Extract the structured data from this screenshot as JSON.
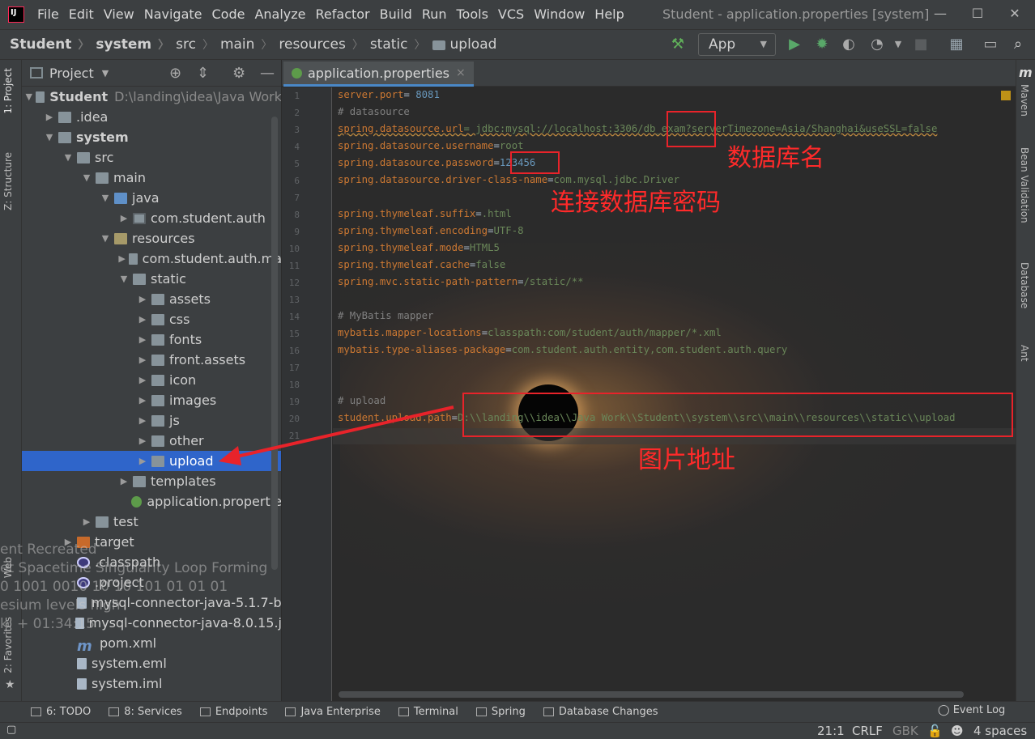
{
  "window": {
    "title": "Student - application.properties [system]"
  },
  "menu": [
    {
      "label": "File"
    },
    {
      "label": "Edit"
    },
    {
      "label": "View"
    },
    {
      "label": "Navigate"
    },
    {
      "label": "Code"
    },
    {
      "label": "Analyze"
    },
    {
      "label": "Refactor"
    },
    {
      "label": "Build"
    },
    {
      "label": "Run"
    },
    {
      "label": "Tools"
    },
    {
      "label": "VCS"
    },
    {
      "label": "Window"
    },
    {
      "label": "Help"
    }
  ],
  "breadcrumb": [
    "Student",
    "system",
    "src",
    "main",
    "resources",
    "static",
    "upload"
  ],
  "toolbar": {
    "run_config": "App",
    "icons": [
      "build-hammer-icon",
      "run-icon",
      "debug-icon",
      "coverage-icon",
      "profile-icon",
      "stop-icon",
      "project-structure-icon",
      "terminal-icon",
      "search-icon"
    ]
  },
  "left_stripe": {
    "project_tab": "1: Project",
    "structure_tab": "Z: Structure",
    "web_tab": "Web",
    "favorites_tab": "2: Favorites"
  },
  "project_panel": {
    "header": "Project",
    "tree": [
      {
        "label": "Student",
        "extra": "D:\\landing\\idea\\Java Work",
        "depth": 0,
        "arrow": "open",
        "icon": "folder",
        "bold": true
      },
      {
        "label": ".idea",
        "depth": 1,
        "arrow": "closed",
        "icon": "folder"
      },
      {
        "label": "system",
        "depth": 1,
        "arrow": "open",
        "icon": "folder",
        "bold": true
      },
      {
        "label": "src",
        "depth": 2,
        "arrow": "open",
        "icon": "folder"
      },
      {
        "label": "main",
        "depth": 3,
        "arrow": "open",
        "icon": "folder"
      },
      {
        "label": "java",
        "depth": 4,
        "arrow": "open",
        "icon": "src"
      },
      {
        "label": "com.student.auth",
        "depth": 5,
        "arrow": "closed",
        "icon": "pkg"
      },
      {
        "label": "resources",
        "depth": 4,
        "arrow": "open",
        "icon": "res"
      },
      {
        "label": "com.student.auth.ma",
        "depth": 5,
        "arrow": "closed",
        "icon": "folder"
      },
      {
        "label": "static",
        "depth": 5,
        "arrow": "open",
        "icon": "folder"
      },
      {
        "label": "assets",
        "depth": 6,
        "arrow": "closed",
        "icon": "folder"
      },
      {
        "label": "css",
        "depth": 6,
        "arrow": "closed",
        "icon": "folder"
      },
      {
        "label": "fonts",
        "depth": 6,
        "arrow": "closed",
        "icon": "folder"
      },
      {
        "label": "front.assets",
        "depth": 6,
        "arrow": "closed",
        "icon": "folder"
      },
      {
        "label": "icon",
        "depth": 6,
        "arrow": "closed",
        "icon": "folder"
      },
      {
        "label": "images",
        "depth": 6,
        "arrow": "closed",
        "icon": "folder"
      },
      {
        "label": "js",
        "depth": 6,
        "arrow": "closed",
        "icon": "folder"
      },
      {
        "label": "other",
        "depth": 6,
        "arrow": "closed",
        "icon": "folder"
      },
      {
        "label": "upload",
        "depth": 6,
        "arrow": "closed",
        "icon": "folder",
        "selected": true
      },
      {
        "label": "templates",
        "depth": 5,
        "arrow": "closed",
        "icon": "folder"
      },
      {
        "label": "application.propertie",
        "depth": 5,
        "arrow": "none",
        "icon": "props"
      },
      {
        "label": "test",
        "depth": 3,
        "arrow": "closed",
        "icon": "folder"
      },
      {
        "label": "target",
        "depth": 2,
        "arrow": "closed",
        "icon": "target"
      },
      {
        "label": ".classpath",
        "depth": 2,
        "arrow": "none",
        "icon": "eclipse"
      },
      {
        "label": ".project",
        "depth": 2,
        "arrow": "none",
        "icon": "eclipse"
      },
      {
        "label": "mysql-connector-java-5.1.7-b",
        "depth": 2,
        "arrow": "none",
        "icon": "file"
      },
      {
        "label": "mysql-connector-java-8.0.15.j",
        "depth": 2,
        "arrow": "none",
        "icon": "file"
      },
      {
        "label": "pom.xml",
        "depth": 2,
        "arrow": "none",
        "icon": "maven"
      },
      {
        "label": "system.eml",
        "depth": 2,
        "arrow": "none",
        "icon": "file"
      },
      {
        "label": "system.iml",
        "depth": 2,
        "arrow": "none",
        "icon": "file"
      }
    ]
  },
  "editor": {
    "tab_label": "application.properties",
    "lines": [
      {
        "n": "1",
        "parts": [
          {
            "t": "server.port",
            "c": "k"
          },
          {
            "t": "= ",
            "c": "val"
          },
          {
            "t": "8081",
            "c": "n"
          }
        ]
      },
      {
        "n": "2",
        "parts": [
          {
            "t": "# datasource",
            "c": "c"
          }
        ]
      },
      {
        "n": "3",
        "parts": [
          {
            "t": "spring.datasource.url",
            "c": "k squig"
          },
          {
            "t": "= jdbc:mysql://localhost:3306/db_exam?serverTimezone=Asia/Shanghai&useSSL=false",
            "c": "v squig"
          }
        ]
      },
      {
        "n": "4",
        "parts": [
          {
            "t": "spring.datasource.username",
            "c": "k"
          },
          {
            "t": "=",
            "c": "val"
          },
          {
            "t": "root",
            "c": "v"
          }
        ]
      },
      {
        "n": "5",
        "parts": [
          {
            "t": "spring.datasource.password",
            "c": "k"
          },
          {
            "t": "=",
            "c": "val"
          },
          {
            "t": "123456",
            "c": "n"
          }
        ]
      },
      {
        "n": "6",
        "parts": [
          {
            "t": "spring.datasource.driver-class-name",
            "c": "k"
          },
          {
            "t": "=",
            "c": "val"
          },
          {
            "t": "com.mysql.jdbc.Driver",
            "c": "v"
          }
        ]
      },
      {
        "n": "7",
        "parts": []
      },
      {
        "n": "8",
        "parts": [
          {
            "t": "spring.thymeleaf.suffix",
            "c": "k"
          },
          {
            "t": "=",
            "c": "val"
          },
          {
            "t": ".html",
            "c": "v"
          }
        ]
      },
      {
        "n": "9",
        "parts": [
          {
            "t": "spring.thymeleaf.encoding",
            "c": "k"
          },
          {
            "t": "=",
            "c": "val"
          },
          {
            "t": "UTF-8",
            "c": "v"
          }
        ]
      },
      {
        "n": "10",
        "parts": [
          {
            "t": "spring.thymeleaf.mode",
            "c": "k"
          },
          {
            "t": "=",
            "c": "val"
          },
          {
            "t": "HTML5",
            "c": "v"
          }
        ]
      },
      {
        "n": "11",
        "parts": [
          {
            "t": "spring.thymeleaf.cache",
            "c": "k"
          },
          {
            "t": "=",
            "c": "val"
          },
          {
            "t": "false",
            "c": "v"
          }
        ]
      },
      {
        "n": "12",
        "parts": [
          {
            "t": "spring.mvc.static-path-pattern",
            "c": "k"
          },
          {
            "t": "=",
            "c": "val"
          },
          {
            "t": "/static/**",
            "c": "v"
          }
        ]
      },
      {
        "n": "13",
        "parts": []
      },
      {
        "n": "14",
        "parts": [
          {
            "t": "# MyBatis mapper",
            "c": "c"
          }
        ]
      },
      {
        "n": "15",
        "parts": [
          {
            "t": "mybatis.mapper-locations",
            "c": "k"
          },
          {
            "t": "=",
            "c": "val"
          },
          {
            "t": "classpath:com/student/auth/mapper/*.xml",
            "c": "v"
          }
        ]
      },
      {
        "n": "16",
        "parts": [
          {
            "t": "mybatis.type-aliases-package",
            "c": "k"
          },
          {
            "t": "=",
            "c": "val"
          },
          {
            "t": "com.student.auth.entity,com.student.auth.query",
            "c": "v"
          }
        ]
      },
      {
        "n": "17",
        "parts": []
      },
      {
        "n": "18",
        "parts": []
      },
      {
        "n": "19",
        "parts": [
          {
            "t": "# upload",
            "c": "c"
          }
        ]
      },
      {
        "n": "20",
        "parts": [
          {
            "t": "student.upload.path",
            "c": "k"
          },
          {
            "t": "=",
            "c": "val"
          },
          {
            "t": "D:\\\\landing\\\\idea\\\\Java Work\\\\Student\\\\system\\\\src\\\\main\\\\resources\\\\static\\\\upload",
            "c": "v"
          }
        ]
      },
      {
        "n": "21",
        "parts": []
      }
    ]
  },
  "annotations": {
    "db_name": "数据库名",
    "db_password": "连接数据库密码",
    "image_path": "图片地址"
  },
  "wallpaper_text": {
    "line1": "ent Recreated",
    "line2": "et Spacetime Singularity Loop Forming",
    "line3": "0 1001 0010 10 10 101 01 01 01",
    "line4": "esium levels high",
    "line5": "k: + 01:34:15"
  },
  "right_stripe": {
    "maven": "Maven",
    "bean_validation": "Bean Validation",
    "database": "Database",
    "ant": "Ant"
  },
  "bottom_tools": [
    {
      "label": "6: TODO"
    },
    {
      "label": "8: Services"
    },
    {
      "label": "Endpoints"
    },
    {
      "label": "Java Enterprise"
    },
    {
      "label": "Terminal"
    },
    {
      "label": "Spring"
    },
    {
      "label": "Database Changes"
    }
  ],
  "event_log": "Event Log",
  "status": {
    "position": "21:1",
    "line_sep": "CRLF",
    "encoding": "GBK",
    "indent": "4 spaces"
  }
}
